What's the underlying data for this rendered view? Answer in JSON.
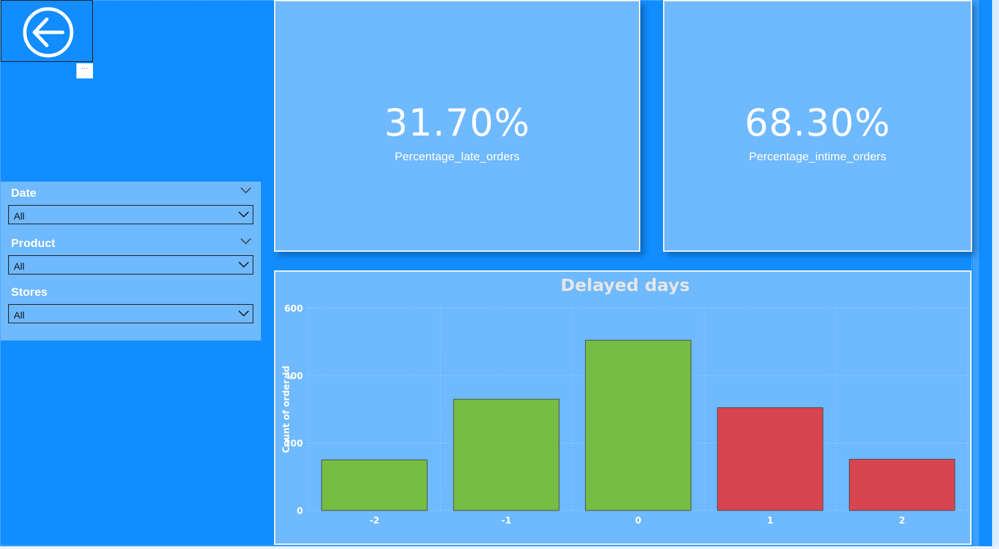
{
  "navigation": {
    "back_icon": "arrow-left-circle-icon",
    "more_options_label": "···"
  },
  "slicers": [
    {
      "title": "Date",
      "value": "All",
      "has_header_chevron": true
    },
    {
      "title": "Product",
      "value": "All",
      "has_header_chevron": true
    },
    {
      "title": "Stores",
      "value": "All",
      "has_header_chevron": false
    }
  ],
  "cards": {
    "late": {
      "value": "31.70%",
      "label": "Percentage_late_orders"
    },
    "intime": {
      "value": "68.30%",
      "label": "Percentage_intime_orders"
    }
  },
  "colors": {
    "background": "#118dff",
    "panel": "#6fb9fe",
    "on_time_bar": "#76bd43",
    "late_bar": "#d64550",
    "chart_title": "#e6e6e6"
  },
  "chart_data": {
    "type": "bar",
    "title": "Delayed days",
    "xlabel": "",
    "ylabel": "Count of order_id",
    "categories": [
      "-2",
      "-1",
      "0",
      "1",
      "2"
    ],
    "values": [
      150,
      330,
      505,
      305,
      152
    ],
    "bar_colors": [
      "#76bd43",
      "#76bd43",
      "#76bd43",
      "#d64550",
      "#d64550"
    ],
    "ylim": [
      0,
      600
    ],
    "yticks": [
      "0",
      "200",
      "400",
      "600"
    ],
    "grid": true
  }
}
